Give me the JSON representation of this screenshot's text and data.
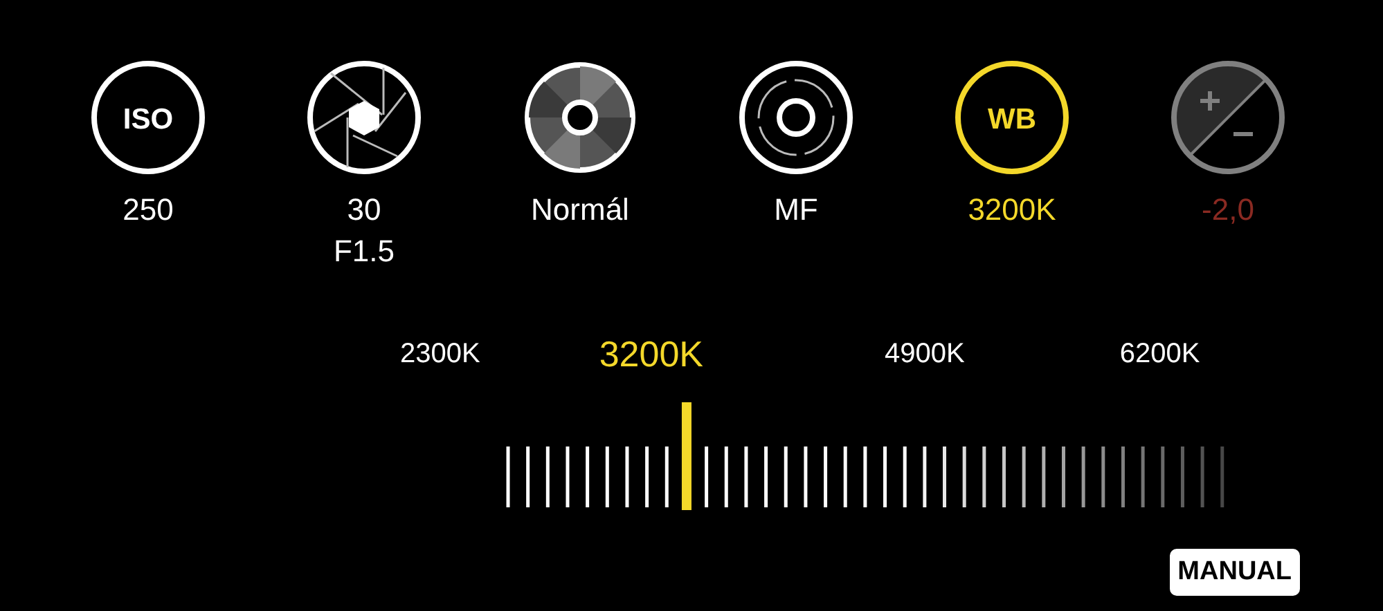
{
  "controls": [
    {
      "kind": "iso",
      "label": "ISO",
      "values": [
        "250"
      ],
      "selected": false,
      "disabled": false
    },
    {
      "kind": "aperture",
      "values": [
        "30",
        "F1.5"
      ],
      "selected": false,
      "disabled": false
    },
    {
      "kind": "metering",
      "values": [
        "Normál"
      ],
      "selected": false,
      "disabled": false
    },
    {
      "kind": "focus",
      "values": [
        "MF"
      ],
      "selected": false,
      "disabled": false
    },
    {
      "kind": "wb",
      "label": "WB",
      "values": [
        "3200K"
      ],
      "selected": true,
      "disabled": false
    },
    {
      "kind": "ev",
      "values": [
        "-2,0"
      ],
      "selected": false,
      "disabled": true
    }
  ],
  "scale": {
    "labels": [
      {
        "text": "2300K",
        "selected": false
      },
      {
        "text": "3200K",
        "selected": true
      },
      {
        "text": "4900K",
        "selected": false
      },
      {
        "text": "6200K",
        "selected": false
      }
    ],
    "level": 0.25
  },
  "mode_badge": "MANUAL"
}
